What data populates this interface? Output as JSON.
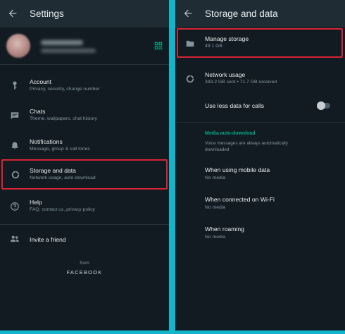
{
  "settings": {
    "title": "Settings",
    "items": [
      {
        "label": "Account",
        "sub": "Privacy, security, change number",
        "icon": "key-icon"
      },
      {
        "label": "Chats",
        "sub": "Theme, wallpapers, chat history",
        "icon": "chat-icon"
      },
      {
        "label": "Notifications",
        "sub": "Message, group & call tones",
        "icon": "bell-icon"
      },
      {
        "label": "Storage and data",
        "sub": "Network usage, auto-download",
        "icon": "data-usage-icon"
      },
      {
        "label": "Help",
        "sub": "FAQ, contact us, privacy policy",
        "icon": "help-icon"
      }
    ],
    "invite": "Invite a friend",
    "footer_from": "from",
    "footer_brand": "FACEBOOK"
  },
  "storage": {
    "title": "Storage and data",
    "manage": {
      "label": "Manage storage",
      "sub": "49.1 GB",
      "icon": "folder-icon"
    },
    "network": {
      "label": "Network usage",
      "sub": "343.2 GB sent • 71.7 GB received",
      "icon": "data-usage-icon"
    },
    "less_data": {
      "label": "Use less data for calls",
      "enabled": false
    },
    "media_header": "Media auto-download",
    "media_note": [
      "Voice messages are always automatically",
      "downloaded"
    ],
    "mobile": {
      "label": "When using mobile data",
      "sub": "No media"
    },
    "wifi": {
      "label": "When connected on Wi-Fi",
      "sub": "No media"
    },
    "roaming": {
      "label": "When roaming",
      "sub": "No media"
    }
  },
  "colors": {
    "background": "#121b22",
    "appbar": "#1f2c34",
    "accent": "#00a884",
    "highlight": "#d62434",
    "divider": "#12b5c9"
  }
}
